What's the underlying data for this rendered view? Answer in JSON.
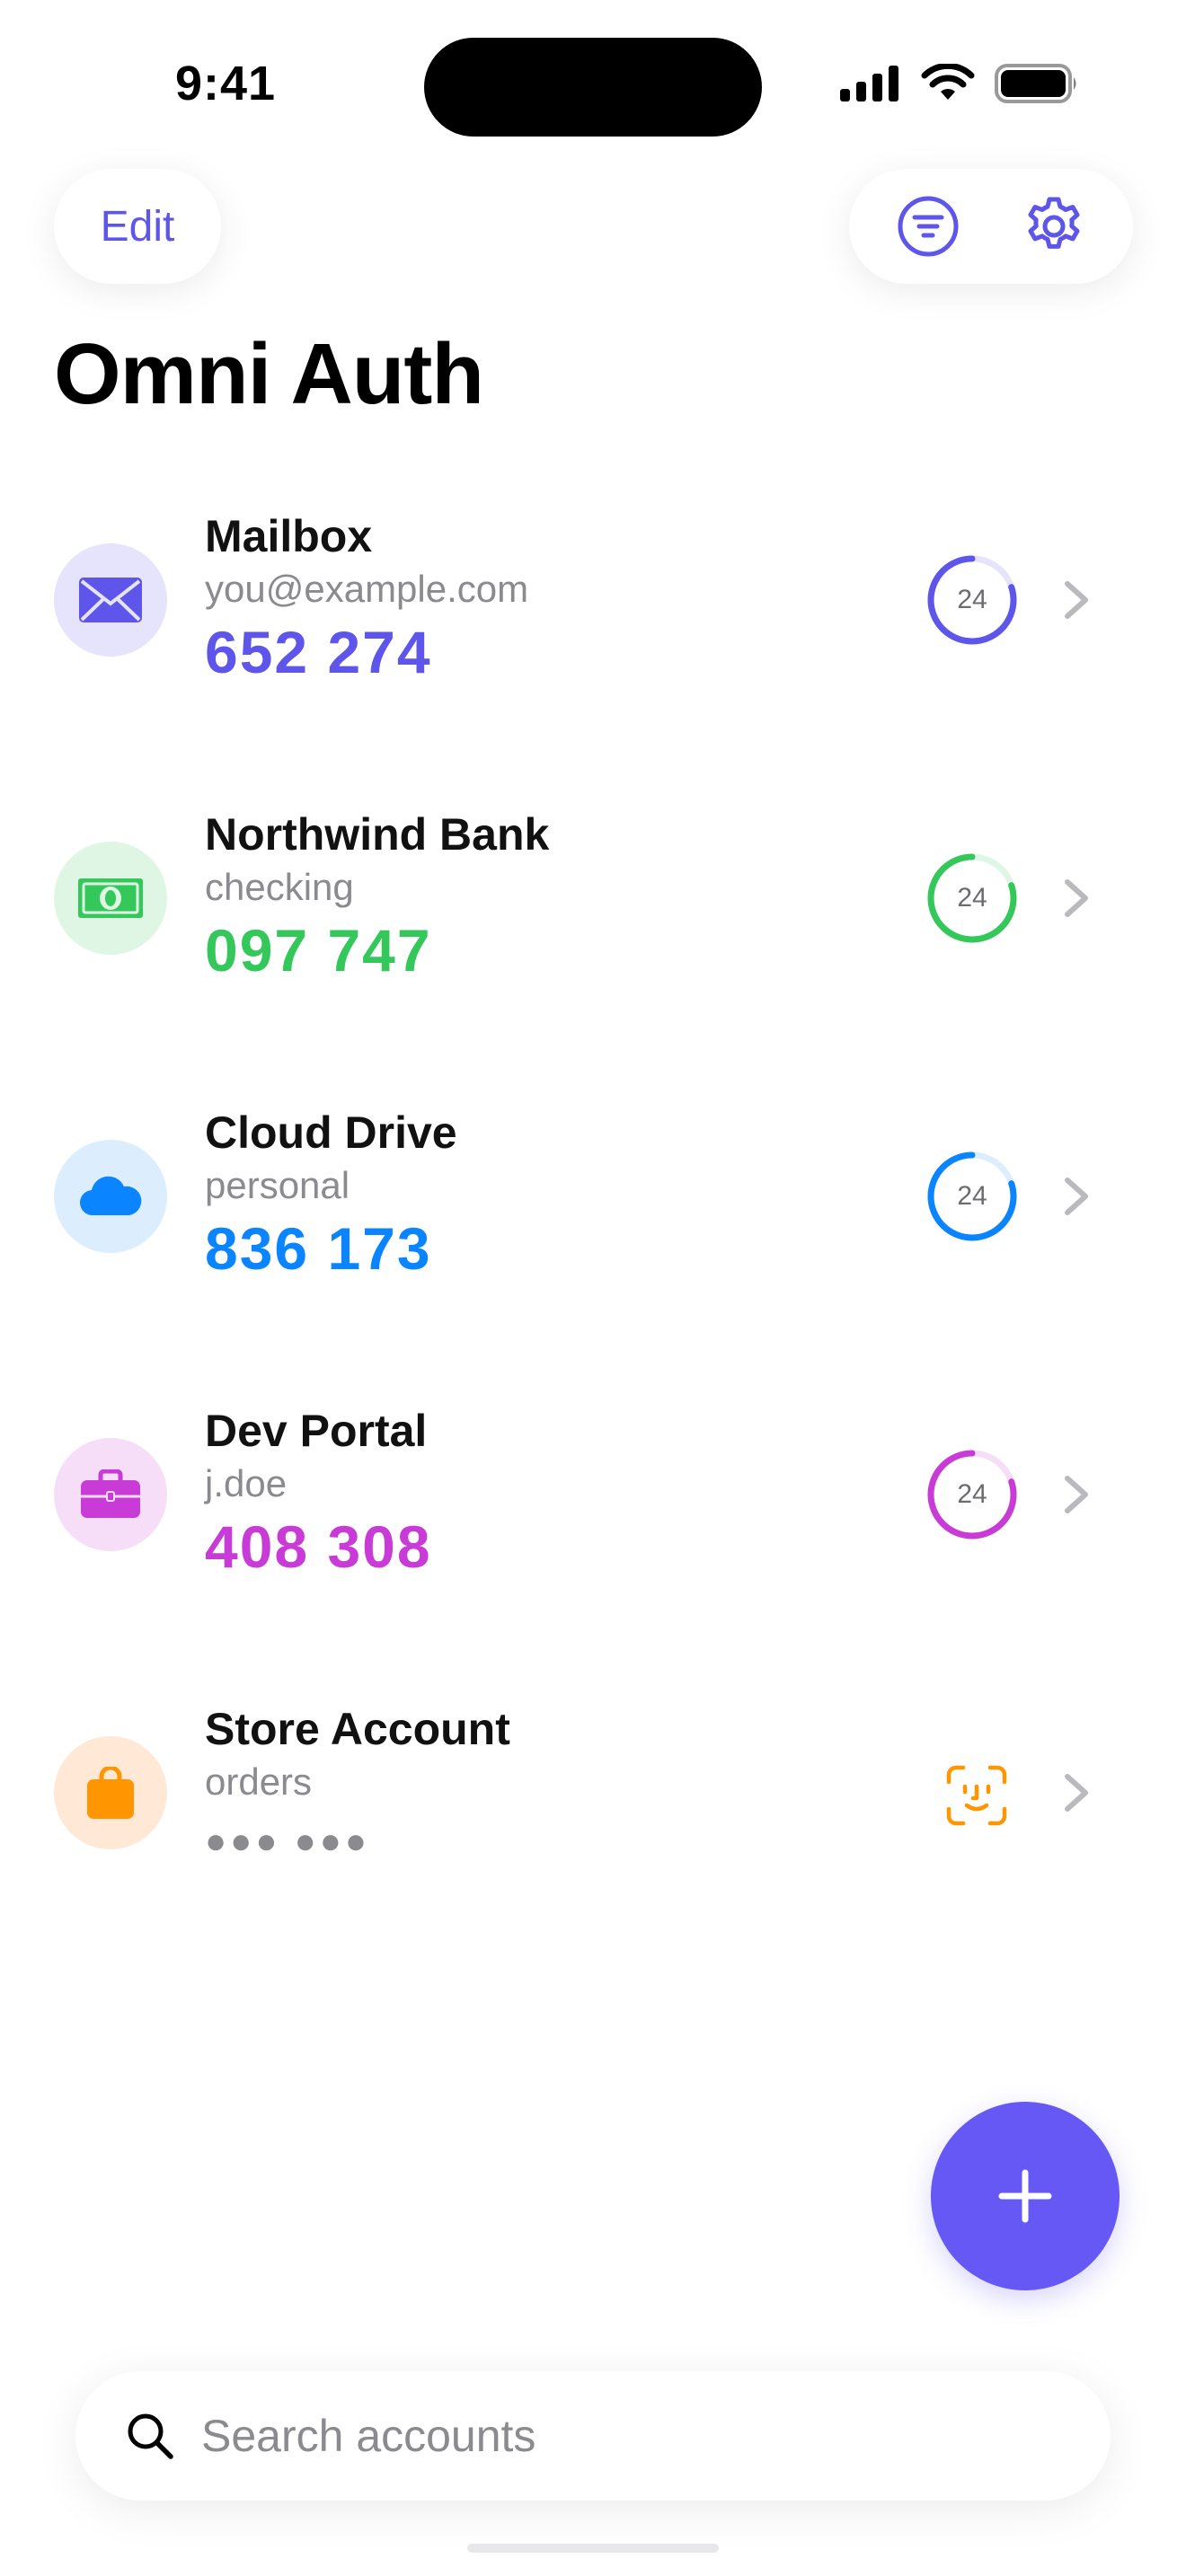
{
  "status_bar": {
    "time": "9:41"
  },
  "header": {
    "edit_label": "Edit",
    "title": "Omni Auth"
  },
  "accounts": [
    {
      "name": "Mailbox",
      "subtitle": "you@example.com",
      "code": "652 274",
      "timer": "24",
      "icon": "envelope-icon",
      "color": "#5E55EA",
      "bg": "#E6E4FD",
      "progress": 0.8
    },
    {
      "name": "Northwind Bank",
      "subtitle": "checking",
      "code": "097 747",
      "timer": "24",
      "icon": "banknote-icon",
      "color": "#34C759",
      "bg": "#DFF6E5",
      "progress": 0.8
    },
    {
      "name": "Cloud Drive",
      "subtitle": "personal",
      "code": "836 173",
      "timer": "24",
      "icon": "cloud-icon",
      "color": "#0A84FF",
      "bg": "#DCEEFE",
      "progress": 0.8
    },
    {
      "name": "Dev Portal",
      "subtitle": "j.doe",
      "code": "408 308",
      "timer": "24",
      "icon": "briefcase-icon",
      "color": "#C93BD6",
      "bg": "#F6DEF8",
      "progress": 0.8
    },
    {
      "name": "Store Account",
      "subtitle": "orders",
      "code": "●●● ●●●",
      "icon": "shopping-bag-icon",
      "color": "#FF9500",
      "bg": "#FFE9D6",
      "locked": true
    }
  ],
  "search": {
    "placeholder": "Search accounts"
  },
  "colors": {
    "accent": "#5E55EA",
    "fab": "#6558F5"
  }
}
